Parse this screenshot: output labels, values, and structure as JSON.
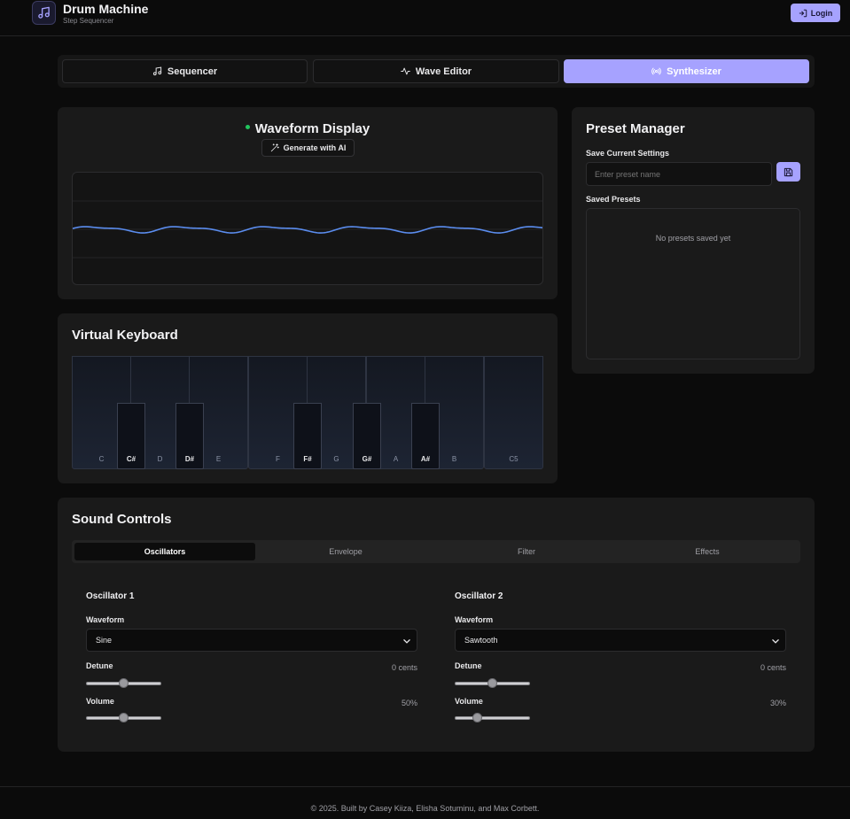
{
  "header": {
    "title": "Drum Machine",
    "subtitle": "Step Sequencer",
    "login_label": "Login"
  },
  "main_tabs": [
    {
      "label": "Sequencer",
      "icon": "music-note-icon",
      "active": false
    },
    {
      "label": "Wave Editor",
      "icon": "activity-icon",
      "active": false
    },
    {
      "label": "Synthesizer",
      "icon": "radio-icon",
      "active": true
    }
  ],
  "waveform": {
    "title": "Waveform Display",
    "ai_button": "Generate with AI"
  },
  "keyboard": {
    "title": "Virtual Keyboard",
    "white_keys": [
      "C",
      "D",
      "E",
      "F",
      "G",
      "A",
      "B",
      "C5"
    ],
    "black_keys": [
      "C#",
      "D#",
      "F#",
      "G#",
      "A#"
    ]
  },
  "presets": {
    "title": "Preset Manager",
    "save_label": "Save Current Settings",
    "input_placeholder": "Enter preset name",
    "saved_label": "Saved Presets",
    "empty_text": "No presets saved yet"
  },
  "sound_controls": {
    "title": "Sound Controls",
    "tabs": [
      {
        "label": "Oscillators",
        "active": true
      },
      {
        "label": "Envelope",
        "active": false
      },
      {
        "label": "Filter",
        "active": false
      },
      {
        "label": "Effects",
        "active": false
      }
    ],
    "oscillators": [
      {
        "title": "Oscillator 1",
        "waveform_label": "Waveform",
        "waveform": "Sine",
        "detune_label": "Detune",
        "detune_value": "0 cents",
        "detune_fraction": 0.5,
        "volume_label": "Volume",
        "volume_value": "50%",
        "volume_fraction": 0.5
      },
      {
        "title": "Oscillator 2",
        "waveform_label": "Waveform",
        "waveform": "Sawtooth",
        "detune_label": "Detune",
        "detune_value": "0 cents",
        "detune_fraction": 0.5,
        "volume_label": "Volume",
        "volume_value": "30%",
        "volume_fraction": 0.3
      }
    ]
  },
  "footer": {
    "text": "© 2025. Built by Casey Kiiza, Elisha Sotuminu, and Max Corbett."
  },
  "colors": {
    "accent": "#a6a2ff",
    "background": "#0b0b0b",
    "panel": "#1a1a1a",
    "wave_line": "#5b8def",
    "status_dot": "#22c55e"
  }
}
